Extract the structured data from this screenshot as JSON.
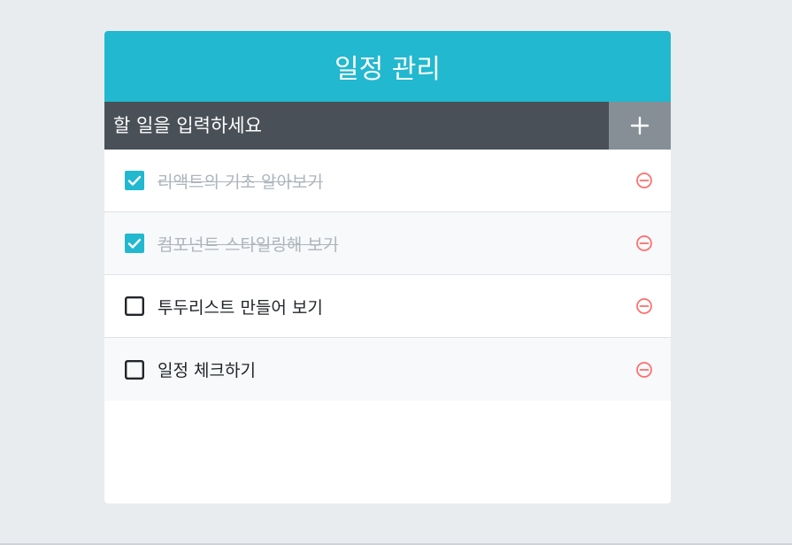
{
  "app": {
    "title": "일정 관리"
  },
  "insert": {
    "placeholder": "할 일을 입력하세요",
    "button_icon": "plus-icon"
  },
  "todos": [
    {
      "text": "리액트의 기초 알아보기",
      "checked": true
    },
    {
      "text": "컴포넌트 스타일링해 보기",
      "checked": true
    },
    {
      "text": "투두리스트 만들어 보기",
      "checked": false
    },
    {
      "text": "일정 체크하기",
      "checked": false
    }
  ],
  "icons": {
    "checked": "checkbox-checked-icon",
    "unchecked": "checkbox-unchecked-icon",
    "remove": "remove-circle-icon"
  },
  "colors": {
    "page_bg": "#e9ecef",
    "header_bg": "#22b8cf",
    "input_bar_bg": "#495057",
    "add_button_bg": "#868e96",
    "check_accent": "#22b8cf",
    "done_text": "#adb5bd",
    "remove_icon": "#ff6b6b"
  }
}
